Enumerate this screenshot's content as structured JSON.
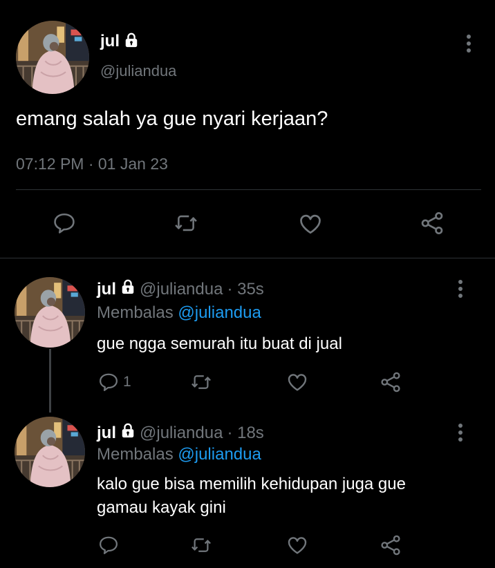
{
  "main_tweet": {
    "name": "jul",
    "handle": "@juliandua",
    "text": "emang salah ya gue nyari kerjaan?",
    "timestamp": "07:12 PM · 01 Jan 23"
  },
  "replies": [
    {
      "name": "jul",
      "handle": "@juliandua",
      "age": "· 35s",
      "replying_prefix": "Membalas",
      "replying_to": "@juliandua",
      "text": "gue ngga semurah itu buat di jual",
      "reply_count": "1"
    },
    {
      "name": "jul",
      "handle": "@juliandua",
      "age": "· 18s",
      "replying_prefix": "Membalas",
      "replying_to": "@juliandua",
      "text_line1": "kalo gue bisa memilih kehidupan juga gue",
      "text_line2": "gamau kayak gini",
      "reply_count": ""
    }
  ],
  "colors": {
    "background": "#000000",
    "text": "#e7e9ea",
    "muted": "#71767b",
    "accent": "#1d9bf0",
    "divider": "#2f3336"
  },
  "icons": [
    "lock-icon",
    "more-icon",
    "reply-icon",
    "retweet-icon",
    "like-icon",
    "share-icon"
  ]
}
